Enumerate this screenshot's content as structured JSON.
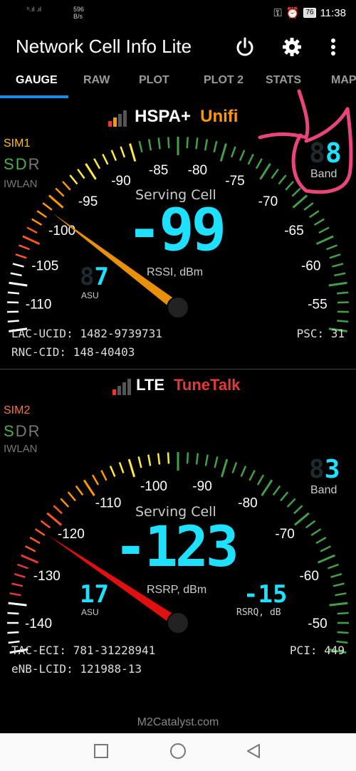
{
  "status_bar": {
    "signal_text": "ʰ.ıl .ıl",
    "speed_value": "596",
    "speed_unit": "B/s",
    "battery": "76",
    "time": "11:38"
  },
  "app_bar": {
    "title": "Network Cell Info Lite",
    "icons": [
      "power-icon",
      "gear-icon",
      "more-vertical-icon"
    ]
  },
  "tabs": [
    "GAUGE",
    "RAW",
    "PLOT",
    "PLOT 2",
    "STATS",
    "MAP"
  ],
  "sim1": {
    "tech": "HSPA+",
    "operator": "Unifi",
    "operator_color": "#ff9800",
    "sim_label": "SIM1",
    "sim_color": "#ffc107",
    "sdr": {
      "s": "S",
      "d": "D",
      "r": "R"
    },
    "iwlan": "IWLAN",
    "band_value": "8",
    "band_label": "Band",
    "serving_cell": "Serving Cell",
    "main_value": "-99",
    "main_label": "RSSI, dBm",
    "asu_value": "7",
    "asu_label": "ASU",
    "ticks": [
      "-110",
      "-105",
      "-100",
      "-95",
      "-90",
      "-85",
      "-80",
      "-75",
      "-70",
      "-65",
      "-60",
      "-55"
    ],
    "needle_value": -99,
    "lac_label": "LAC-UCID:",
    "lac_value": "1482-9739731",
    "rnc_label": "RNC-CID:",
    "rnc_value": "148-40403",
    "psc_label": "PSC:",
    "psc_value": "31"
  },
  "sim2": {
    "tech": "LTE",
    "operator": "TuneTalk",
    "operator_color": "#e53935",
    "sim_label": "SIM2",
    "sim_color": "#ff7043",
    "sdr": {
      "s": "S",
      "d": "D",
      "r": "R"
    },
    "iwlan": "IWLAN",
    "band_value": "3",
    "band_label": "Band",
    "serving_cell": "Serving Cell",
    "main_value": "-123",
    "main_label": "RSRP, dBm",
    "asu_value": "17",
    "asu_label": "ASU",
    "rsrq_value": "-15",
    "rsrq_label": "RSRQ, dB",
    "ticks": [
      "-140",
      "-130",
      "-120",
      "-110",
      "-100",
      "-90",
      "-80",
      "-70",
      "-60",
      "-50"
    ],
    "needle_value": -123,
    "tac_label": "TAC-ECI:",
    "tac_value": "781-31228941",
    "enb_label": "eNB-LCID:",
    "enb_value": "121988-13",
    "pci_label": "PCI:",
    "pci_value": "449"
  },
  "footer": {
    "brand": "M2Catalyst.com"
  },
  "navbar": [
    "back-icon",
    "home-icon",
    "recents-icon"
  ]
}
